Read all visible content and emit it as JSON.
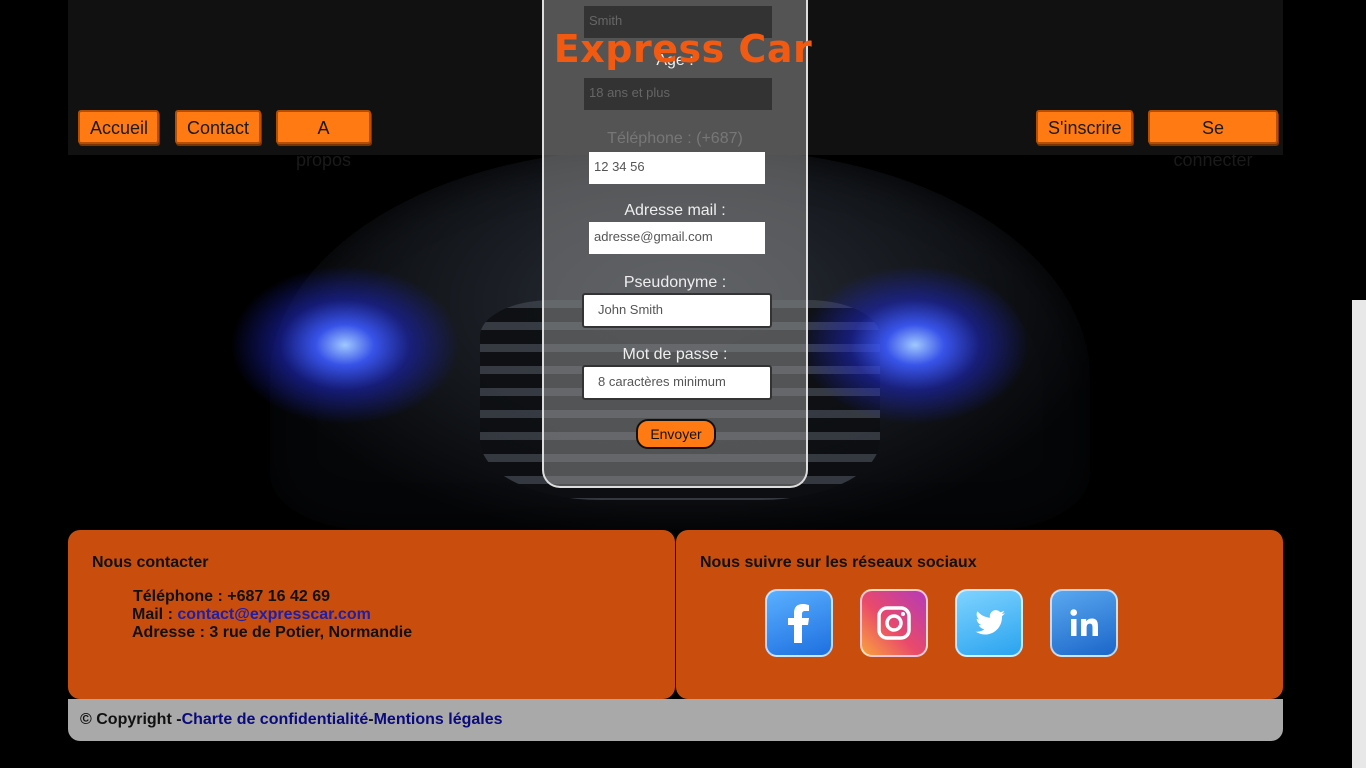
{
  "brand": "Express Car",
  "nav": {
    "left": [
      "Accueil",
      "Contact",
      "A propos"
    ],
    "right": [
      "S'inscrire",
      "Se connecter"
    ]
  },
  "form": {
    "hidden_name_placeholder": "Smith",
    "age_label": "Age :",
    "age_value": "18 ans et plus",
    "phone_label": "Téléphone : (+687)",
    "phone_placeholder": "12 34 56",
    "email_label": "Adresse mail :",
    "email_placeholder": "adresse@gmail.com",
    "pseudo_label": "Pseudonyme :",
    "pseudo_placeholder": "John Smith",
    "password_label": "Mot de passe :",
    "password_placeholder": "8 caractères minimum",
    "submit": "Envoyer"
  },
  "contact": {
    "title": "Nous contacter",
    "phone": "Téléphone : +687 16 42 69",
    "mail_label": "Mail : ",
    "mail_link": "contact@expresscar.com",
    "address": "Adresse : 3 rue de Potier, Normandie"
  },
  "social": {
    "title": "Nous suivre sur les réseaux sociaux",
    "icons": [
      "facebook-icon",
      "instagram-icon",
      "twitter-icon",
      "linkedin-icon"
    ]
  },
  "footer": {
    "copyright": "© Copyright -",
    "privacy": "Charte de confidentialité",
    "separator": "-",
    "legal": "Mentions légales"
  },
  "colors": {
    "accent": "#ff7a12",
    "brand": "#f25a12",
    "footer": "#c94e0e"
  }
}
